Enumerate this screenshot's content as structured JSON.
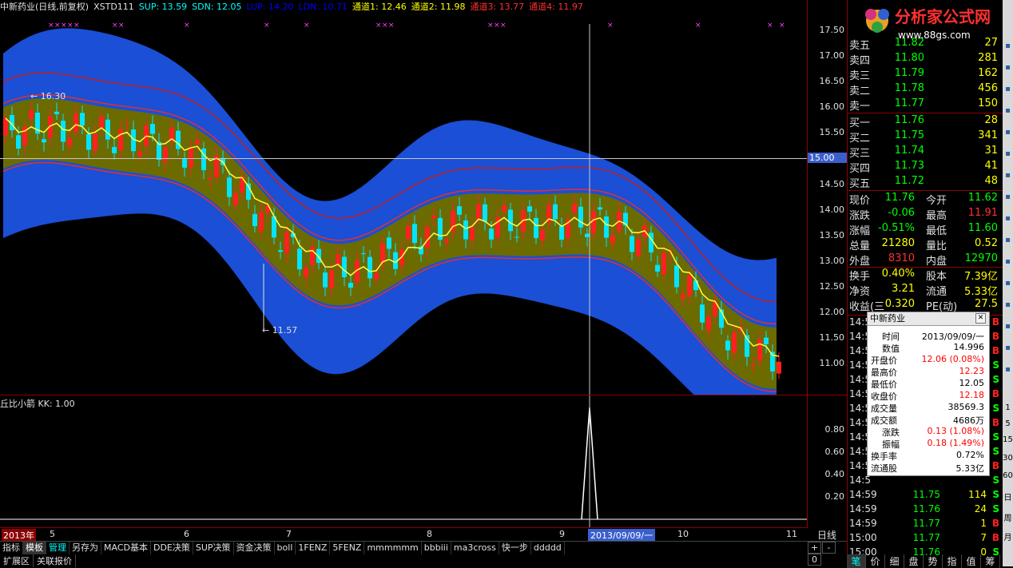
{
  "header": {
    "segments": [
      {
        "text": "中新药业(日线,前复权)",
        "color": "#e0e0e0"
      },
      {
        "text": "XSTD111",
        "color": "#e0e0e0"
      },
      {
        "text": "SUP: 13.59",
        "color": "#00ffff"
      },
      {
        "text": "SDN: 12.05",
        "color": "#00ffff"
      },
      {
        "text": "LUP: 14.20",
        "color": "#0000ff"
      },
      {
        "text": "LDN: 10.71",
        "color": "#0000ff"
      },
      {
        "text": "通道1: 12.46",
        "color": "#ffff00"
      },
      {
        "text": "通道2: 11.98",
        "color": "#ffff00"
      },
      {
        "text": "通道3: 13.77",
        "color": "#ff3030"
      },
      {
        "text": "通道4: 11.97",
        "color": "#ff3030"
      }
    ]
  },
  "main_axis": {
    "ticks": [
      "17.50",
      "17.00",
      "16.50",
      "16.00",
      "15.50",
      "15.00",
      "14.50",
      "14.00",
      "13.50",
      "13.00",
      "12.50",
      "12.00",
      "11.50",
      "11.00"
    ],
    "cursor_value": "15.00"
  },
  "sub_head": "丘比小箭 KK: 1.00",
  "sub_axis": {
    "ticks": [
      "0.80",
      "0.60",
      "0.40",
      "0.20"
    ]
  },
  "annotations": {
    "high": "16.30",
    "low": "11.57"
  },
  "dates": {
    "year": "2013年",
    "months": [
      "5",
      "6",
      "7",
      "8",
      "9",
      "10",
      "11"
    ],
    "cursor_date": "2013/09/09/一"
  },
  "period": "日线",
  "controls": [
    "+",
    "-",
    "0"
  ],
  "tabs": [
    "指标",
    "模板",
    "管理",
    "另存为",
    "MACD基本",
    "DDE决策",
    "SUP决策",
    "资金决策",
    "boll",
    "1FENZ",
    "5FENZ",
    "mmmmmm",
    "bbbiii",
    "ma3cross",
    "快一步",
    "ddddd"
  ],
  "active_tab": "模板",
  "bottom_tabs": [
    "扩展区",
    "关联报价"
  ],
  "logo": {
    "text": "分析家公式网",
    "url": "www.88gs.com"
  },
  "order_book": {
    "sells": [
      {
        "label": "卖五",
        "price": "11.82",
        "vol": "27"
      },
      {
        "label": "卖四",
        "price": "11.80",
        "vol": "281"
      },
      {
        "label": "卖三",
        "price": "11.79",
        "vol": "162"
      },
      {
        "label": "卖二",
        "price": "11.78",
        "vol": "456"
      },
      {
        "label": "卖一",
        "price": "11.77",
        "vol": "150"
      }
    ],
    "buys": [
      {
        "label": "买一",
        "price": "11.76",
        "vol": "28"
      },
      {
        "label": "买二",
        "price": "11.75",
        "vol": "341"
      },
      {
        "label": "买三",
        "price": "11.74",
        "vol": "31"
      },
      {
        "label": "买四",
        "price": "11.73",
        "vol": "41"
      },
      {
        "label": "买五",
        "price": "11.72",
        "vol": "48"
      }
    ]
  },
  "quote": [
    {
      "l1": "现价",
      "v1": "11.76",
      "c1": "#00ff00",
      "l2": "今开",
      "v2": "11.62",
      "c2": "#00ff00"
    },
    {
      "l1": "涨跌",
      "v1": "-0.06",
      "c1": "#00ff00",
      "l2": "最高",
      "v2": "11.91",
      "c2": "#ff3030"
    },
    {
      "l1": "涨幅",
      "v1": "-0.51%",
      "c1": "#00ff00",
      "l2": "最低",
      "v2": "11.60",
      "c2": "#00ff00"
    },
    {
      "l1": "总量",
      "v1": "21280",
      "c1": "#ffff00",
      "l2": "量比",
      "v2": "0.52",
      "c2": "#ffff00"
    },
    {
      "l1": "外盘",
      "v1": "8310",
      "c1": "#ff3030",
      "l2": "内盘",
      "v2": "12970",
      "c2": "#00ff00"
    },
    {
      "l1": "换手",
      "v1": "0.40%",
      "c1": "#ffff00",
      "l2": "股本",
      "v2": "7.39亿",
      "c2": "#ffff00"
    },
    {
      "l1": "净资",
      "v1": "3.21",
      "c1": "#ffff00",
      "l2": "流通",
      "v2": "5.33亿",
      "c2": "#ffff00"
    },
    {
      "l1": "收益(三",
      "v1": "0.320",
      "c1": "#ffff00",
      "l2": "PE(动)",
      "v2": "27.5",
      "c2": "#ffff00"
    }
  ],
  "trades": [
    {
      "t": "14:5",
      "p": "",
      "n": "",
      "d": "B"
    },
    {
      "t": "14:5",
      "p": "",
      "n": "",
      "d": "B"
    },
    {
      "t": "14:5",
      "p": "",
      "n": "",
      "d": "B"
    },
    {
      "t": "14:5",
      "p": "",
      "n": "",
      "d": "S"
    },
    {
      "t": "14:5",
      "p": "",
      "n": "",
      "d": "S"
    },
    {
      "t": "14:5",
      "p": "",
      "n": "",
      "d": "B"
    },
    {
      "t": "14:5",
      "p": "",
      "n": "",
      "d": "S"
    },
    {
      "t": "14:5",
      "p": "",
      "n": "",
      "d": "B"
    },
    {
      "t": "14:5",
      "p": "",
      "n": "",
      "d": "S"
    },
    {
      "t": "14:5",
      "p": "",
      "n": "",
      "d": "S"
    },
    {
      "t": "14:5",
      "p": "",
      "n": "",
      "d": "B"
    },
    {
      "t": "14:5",
      "p": "",
      "n": "",
      "d": "S"
    },
    {
      "t": "14:59",
      "p": "11.75",
      "n": "114",
      "d": "S"
    },
    {
      "t": "14:59",
      "p": "11.76",
      "n": "24",
      "d": "S"
    },
    {
      "t": "14:59",
      "p": "11.77",
      "n": "1",
      "d": "B"
    },
    {
      "t": "15:00",
      "p": "11.77",
      "n": "7",
      "d": "B"
    },
    {
      "t": "15:00",
      "p": "11.76",
      "n": "0",
      "d": "S"
    }
  ],
  "popup": {
    "title": "中新药业",
    "rows": [
      {
        "l": "时间",
        "v": "2013/09/09/一",
        "c": "#000"
      },
      {
        "l": "数值",
        "v": "14.996",
        "c": "#000"
      },
      {
        "l": "开盘价",
        "v": "12.06 (0.08%)",
        "c": "#ff0000"
      },
      {
        "l": "最高价",
        "v": "12.23",
        "c": "#ff0000"
      },
      {
        "l": "最低价",
        "v": "12.05",
        "c": "#000"
      },
      {
        "l": "收盘价",
        "v": "12.18",
        "c": "#ff0000"
      },
      {
        "l": "成交量",
        "v": "38569.3",
        "c": "#000"
      },
      {
        "l": "成交额",
        "v": "4686万",
        "c": "#000"
      },
      {
        "l": "涨跌",
        "v": "0.13 (1.08%)",
        "c": "#ff0000"
      },
      {
        "l": "振幅",
        "v": "0.18 (1.49%)",
        "c": "#ff0000"
      },
      {
        "l": "换手率",
        "v": "0.72%",
        "c": "#000"
      },
      {
        "l": "流通股",
        "v": "5.33亿",
        "c": "#000"
      }
    ]
  },
  "side_tabs": [
    "笔",
    "价",
    "细",
    "盘",
    "势",
    "指",
    "值",
    "筹"
  ],
  "toolbar_labels": [
    "1",
    "5",
    "15",
    "30",
    "60",
    "日",
    "周",
    "月"
  ],
  "colors": {
    "up": "#ff0000",
    "down": "#00ffff",
    "bg": "#000000",
    "band_outer": "#1a4fd6",
    "band_inner": "#6b6b00",
    "grid": "#8b0000"
  }
}
